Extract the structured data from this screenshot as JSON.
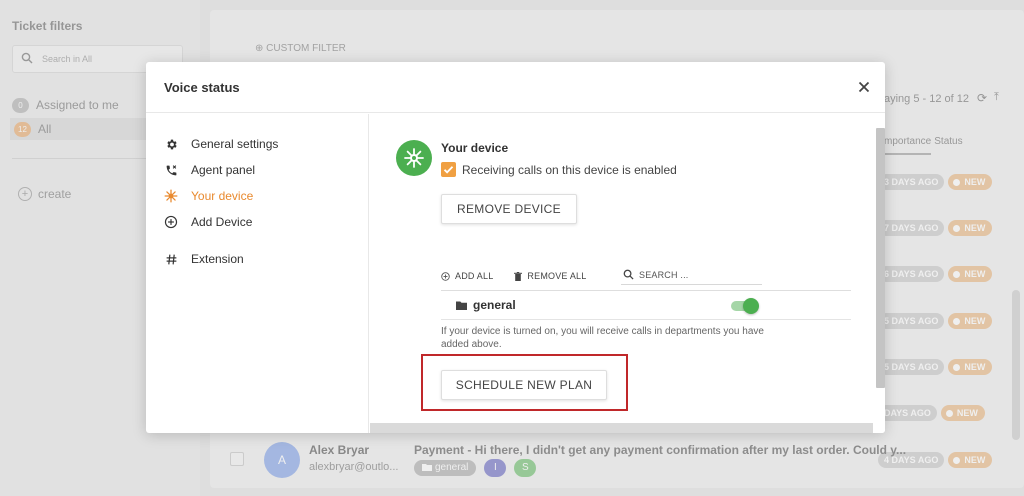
{
  "sidebar": {
    "title": "Ticket filters",
    "search_placeholder": "Search in All",
    "filters": [
      {
        "count": "0",
        "label": "Assigned to me"
      },
      {
        "count": "12",
        "label": "All"
      }
    ],
    "create_label": "create"
  },
  "main": {
    "custom_filter": "CUSTOM FILTER",
    "displaying": "aying 5 - 12 of 12",
    "columns": [
      "mportance",
      "Status"
    ],
    "rows_badges": [
      {
        "days": "3 DAYS AGO",
        "status": "NEW"
      },
      {
        "days": "7 DAYS AGO",
        "status": "NEW"
      },
      {
        "days": "6 DAYS AGO",
        "status": "NEW"
      },
      {
        "days": "5 DAYS AGO",
        "status": "NEW"
      },
      {
        "days": "5 DAYS AGO",
        "status": "NEW"
      },
      {
        "days": "DAYS AGO",
        "status": "NEW"
      },
      {
        "days": "4 DAYS AGO",
        "status": "NEW"
      }
    ],
    "ticket": {
      "avatar": "A",
      "name": "Alex Bryar",
      "email": "alexbryar@outlo...",
      "subject": "Payment - Hi there, I didn't get any payment confirmation after my last order. Could y...",
      "department": "general",
      "tag_i": "I",
      "tag_s": "S"
    }
  },
  "modal": {
    "title": "Voice status",
    "nav": [
      {
        "label": "General settings",
        "icon": "gear-icon"
      },
      {
        "label": "Agent panel",
        "icon": "phone-icon"
      },
      {
        "label": "Your device",
        "icon": "device-icon"
      },
      {
        "label": "Add Device",
        "icon": "add-circle-icon"
      },
      {
        "label": "Extension",
        "icon": "hash-icon"
      }
    ],
    "device": {
      "title": "Your device",
      "receiving_label": "Receiving calls on this device is enabled",
      "remove_button": "REMOVE DEVICE",
      "add_all": "ADD ALL",
      "remove_all": "REMOVE ALL",
      "search_placeholder": "SEARCH ...",
      "department": "general",
      "help_text": "If your device is turned on, you will receive calls in departments you have added above.",
      "schedule_button": "SCHEDULE NEW PLAN"
    }
  },
  "colors": {
    "accent_orange": "#e98a2f",
    "device_green": "#4caf50",
    "highlight_red": "#c0282a"
  }
}
